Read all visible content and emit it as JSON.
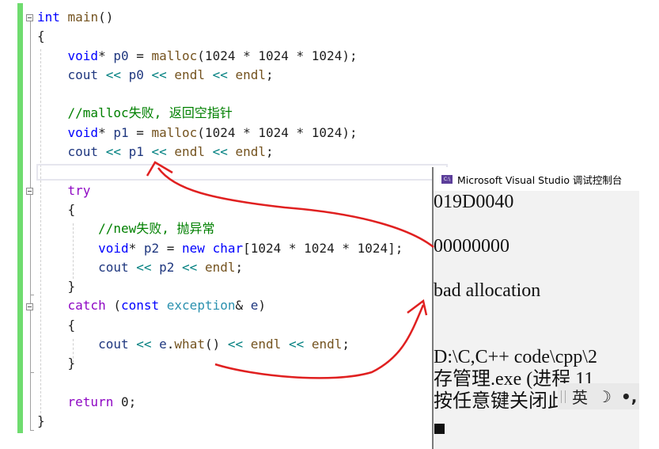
{
  "editor": {
    "lines": [
      [
        {
          "t": "int",
          "c": "kw"
        },
        {
          "t": " "
        },
        {
          "t": "main",
          "c": "fn"
        },
        {
          "t": "()"
        }
      ],
      [
        {
          "t": "{"
        }
      ],
      [
        {
          "t": "    "
        },
        {
          "t": "void",
          "c": "kw"
        },
        {
          "t": "* "
        },
        {
          "t": "p0",
          "c": "var"
        },
        {
          "t": " = "
        },
        {
          "t": "malloc",
          "c": "fn"
        },
        {
          "t": "(1024 * 1024 * 1024);"
        }
      ],
      [
        {
          "t": "    "
        },
        {
          "t": "cout",
          "c": "var"
        },
        {
          "t": " "
        },
        {
          "t": "<<",
          "c": "op"
        },
        {
          "t": " "
        },
        {
          "t": "p0",
          "c": "var"
        },
        {
          "t": " "
        },
        {
          "t": "<<",
          "c": "op"
        },
        {
          "t": " "
        },
        {
          "t": "endl",
          "c": "fn"
        },
        {
          "t": " "
        },
        {
          "t": "<<",
          "c": "op"
        },
        {
          "t": " "
        },
        {
          "t": "endl",
          "c": "fn"
        },
        {
          "t": ";"
        }
      ],
      [
        {
          "t": ""
        }
      ],
      [
        {
          "t": "    "
        },
        {
          "t": "//malloc失败, 返回空指针",
          "c": "cm"
        }
      ],
      [
        {
          "t": "    "
        },
        {
          "t": "void",
          "c": "kw"
        },
        {
          "t": "* "
        },
        {
          "t": "p1",
          "c": "var"
        },
        {
          "t": " = "
        },
        {
          "t": "malloc",
          "c": "fn"
        },
        {
          "t": "(1024 * 1024 * 1024);"
        }
      ],
      [
        {
          "t": "    "
        },
        {
          "t": "cout",
          "c": "var"
        },
        {
          "t": " "
        },
        {
          "t": "<<",
          "c": "op"
        },
        {
          "t": " "
        },
        {
          "t": "p1",
          "c": "var"
        },
        {
          "t": " "
        },
        {
          "t": "<<",
          "c": "op"
        },
        {
          "t": " "
        },
        {
          "t": "endl",
          "c": "fn"
        },
        {
          "t": " "
        },
        {
          "t": "<<",
          "c": "op"
        },
        {
          "t": " "
        },
        {
          "t": "endl",
          "c": "fn"
        },
        {
          "t": ";"
        }
      ],
      [
        {
          "t": ""
        }
      ],
      [
        {
          "t": "    "
        },
        {
          "t": "try",
          "c": "kw2"
        }
      ],
      [
        {
          "t": "    {"
        }
      ],
      [
        {
          "t": "        "
        },
        {
          "t": "//new失败, 抛异常",
          "c": "cm"
        }
      ],
      [
        {
          "t": "        "
        },
        {
          "t": "void",
          "c": "kw"
        },
        {
          "t": "* "
        },
        {
          "t": "p2",
          "c": "var"
        },
        {
          "t": " = "
        },
        {
          "t": "new",
          "c": "kw"
        },
        {
          "t": " "
        },
        {
          "t": "char",
          "c": "kw"
        },
        {
          "t": "[1024 * 1024 * 1024];"
        }
      ],
      [
        {
          "t": "        "
        },
        {
          "t": "cout",
          "c": "var"
        },
        {
          "t": " "
        },
        {
          "t": "<<",
          "c": "op"
        },
        {
          "t": " "
        },
        {
          "t": "p2",
          "c": "var"
        },
        {
          "t": " "
        },
        {
          "t": "<<",
          "c": "op"
        },
        {
          "t": " "
        },
        {
          "t": "endl",
          "c": "fn"
        },
        {
          "t": ";"
        }
      ],
      [
        {
          "t": "    }"
        }
      ],
      [
        {
          "t": "    "
        },
        {
          "t": "catch",
          "c": "kw2"
        },
        {
          "t": " ("
        },
        {
          "t": "const",
          "c": "kw"
        },
        {
          "t": " "
        },
        {
          "t": "exception",
          "c": "ty"
        },
        {
          "t": "& "
        },
        {
          "t": "e",
          "c": "var"
        },
        {
          "t": ")"
        }
      ],
      [
        {
          "t": "    {"
        }
      ],
      [
        {
          "t": "        "
        },
        {
          "t": "cout",
          "c": "var"
        },
        {
          "t": " "
        },
        {
          "t": "<<",
          "c": "op"
        },
        {
          "t": " "
        },
        {
          "t": "e",
          "c": "var"
        },
        {
          "t": "."
        },
        {
          "t": "what",
          "c": "fn"
        },
        {
          "t": "() "
        },
        {
          "t": "<<",
          "c": "op"
        },
        {
          "t": " "
        },
        {
          "t": "endl",
          "c": "fn"
        },
        {
          "t": " "
        },
        {
          "t": "<<",
          "c": "op"
        },
        {
          "t": " "
        },
        {
          "t": "endl",
          "c": "fn"
        },
        {
          "t": ";"
        }
      ],
      [
        {
          "t": "    }"
        }
      ],
      [
        {
          "t": ""
        }
      ],
      [
        {
          "t": "    "
        },
        {
          "t": "return",
          "c": "kw2"
        },
        {
          "t": " 0;"
        }
      ],
      [
        {
          "t": "}"
        }
      ]
    ]
  },
  "console": {
    "title": "Microsoft Visual Studio 调试控制台",
    "icon": "console-app-icon",
    "icon_text": "C:\\",
    "output": [
      "019D0040",
      "",
      "00000000",
      "",
      "bad allocation",
      "",
      "",
      "D:\\C,C++ code\\cpp\\2",
      "存管理.exe (进程 11",
      "按任意键关闭此窗口. . ."
    ]
  },
  "ime": {
    "language": "英",
    "mode_icon": "moon-icon",
    "punct_icon": "punctuation-icon"
  },
  "annotations": {
    "color": "#e02020"
  }
}
